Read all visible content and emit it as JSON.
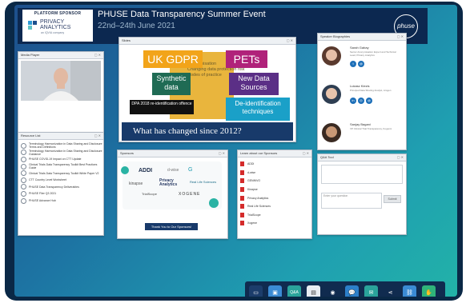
{
  "banner": {
    "sponsor_header": "PLATFORM SPONSOR",
    "sponsor_name": "PRIVACY ANALYTICS",
    "sponsor_sub": "an IQVIA company",
    "event_title": "PHUSE Data Transparency Summer Event",
    "event_date": "22nd–24th June 2021",
    "brand": "phuse"
  },
  "media_player": {
    "title": "Media Player"
  },
  "resource_list": {
    "title": "Resource List",
    "items": [
      "Terminology Harmonization in Data Sharing and Disclosure Terms and Definitions",
      "Terminology Harmonization in Data Sharing and Disclosure Guidance",
      "PHUSE COVID-19 Impact on CTT Update",
      "Clinical Trials Data Transparency Toolkit Best Practices Guide",
      "Clinical Trials Data Transparency Toolkit White Paper V2",
      "CTT Country Level Worksheet",
      "PHUSE Data Transparency Deliverables",
      "PHUSE Flier Q3 2021",
      "PHUSE Advance Hub"
    ]
  },
  "slides": {
    "title": "Slides",
    "boxes": {
      "gdpr": "UK GDPR",
      "pets": "PETs",
      "synthetic": "Synthetic data",
      "newdata": "New Data Sources",
      "dpa": "DPA 2018 re-identification offence",
      "deid": "De-identification techniques",
      "bg1": "Anonymisation",
      "bg2": "Changing data protection risk",
      "bg3": "Codes of practice"
    },
    "caption": "What has changed since 2012?"
  },
  "speakers": {
    "title": "Speaker Biographies",
    "items": [
      {
        "name": "Sarah Gabay",
        "role": "Senior Anonymisation Expert and Technical Lead, Privacy Analytics"
      },
      {
        "name": "Lukasz Kiezis",
        "role": "Principal Data Sharing Analyst, Amgen"
      },
      {
        "name": "Sanjay Bagani",
        "role": "VP Clinical Trial Transparency, Kogenix"
      }
    ]
  },
  "sponsors": {
    "title": "Sponsors",
    "button": "Thank You to Our Sponsors!",
    "logos": [
      "ADDI",
      "d-wise",
      "G",
      "Privacy Analytics",
      "Real Life Sciences",
      "kinapse",
      "TrialScope",
      "XOGENE"
    ]
  },
  "learn_more": {
    "title": "Learn about our Sponsors",
    "items": [
      "ADDI",
      "d-wise",
      "GENINVO",
      "Kinapse",
      "Privacy Analytics",
      "Real Life Sciences",
      "TrialScope",
      "Xogene"
    ]
  },
  "qa": {
    "title": "Q&A Tool",
    "placeholder": "Enter your question",
    "submit": "Submit"
  },
  "toolbar": {
    "icons": [
      "screen-icon",
      "media-icon",
      "qa-icon",
      "notes-icon",
      "resources-icon",
      "chat-icon",
      "email-icon",
      "share-icon",
      "link-icon",
      "hand-icon"
    ],
    "qa_label": "Q&A"
  },
  "colors": {
    "navy": "#0c2850",
    "gdpr": "#f2a41a",
    "pets": "#b0227a",
    "synthetic": "#1f6b54",
    "newdata": "#5b2f86",
    "deid": "#1aa0c8",
    "caption": "#183a6a"
  }
}
